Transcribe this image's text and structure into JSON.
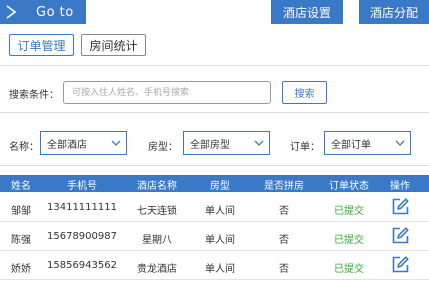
{
  "header": {
    "goto_label": "Go  to",
    "goto_icon": "menu-icon",
    "hotel_settings": "酒店设置",
    "hotel_assign": "酒店分配"
  },
  "tabs": [
    {
      "label": "订单管理",
      "active": true
    },
    {
      "label": "房间统计",
      "active": false
    }
  ],
  "search": {
    "label": "搜索条件：",
    "placeholder": "可按入住人姓名、手机号搜索",
    "value": "",
    "button": "搜索"
  },
  "filters": {
    "name_label": "名称：",
    "name_value": "全部酒店",
    "room_label": "房型：",
    "room_value": "全部房型",
    "order_label": "订单：",
    "order_value": "全部订单"
  },
  "table": {
    "headers": [
      "姓名",
      "手机号",
      "酒店名称",
      "房型",
      "是否拼房",
      "订单状态",
      "操作"
    ],
    "rows": [
      [
        "邹邹",
        "13411111111",
        "七天连锁",
        "单人间",
        "否",
        "已提交"
      ],
      [
        "陈强",
        "15678900987",
        "星期八",
        "单人间",
        "否",
        "已提交"
      ],
      [
        "娇娇",
        "15856943562",
        "贵龙酒店",
        "单人间",
        "否",
        "已提交"
      ]
    ],
    "action_icon": "edit-icon"
  },
  "colors": {
    "primary": "#3a78c8",
    "status_submitted": "#2fae2f"
  }
}
